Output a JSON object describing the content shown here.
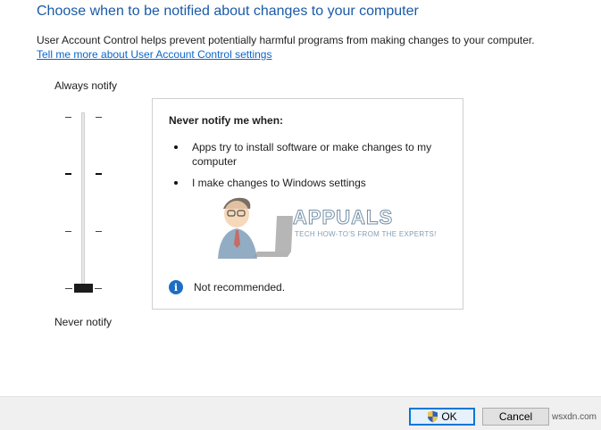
{
  "header": {
    "title": "Choose when to be notified about changes to your computer",
    "description": "User Account Control helps prevent potentially harmful programs from making changes to your computer.",
    "learn_more_link": "Tell me more about User Account Control settings"
  },
  "slider": {
    "top_label": "Always notify",
    "bottom_label": "Never notify",
    "levels": 4,
    "selected_level": 1
  },
  "info_panel": {
    "heading": "Never notify me when:",
    "bullets": [
      "Apps try to install software or make changes to my computer",
      "I make changes to Windows settings"
    ],
    "notice": "Not recommended.",
    "notice_icon": "info-icon"
  },
  "watermark": {
    "brand": "APPUALS",
    "tagline": "TECH HOW-TO'S FROM THE EXPERTS!"
  },
  "buttons": {
    "ok_label": "OK",
    "ok_icon": "uac-shield-icon",
    "cancel_label": "Cancel"
  },
  "credit": "wsxdn.com",
  "colors": {
    "title": "#1a5aa8",
    "link": "#0b66c8",
    "info_icon": "#1c6ec4",
    "ok_border": "#0078d7"
  }
}
